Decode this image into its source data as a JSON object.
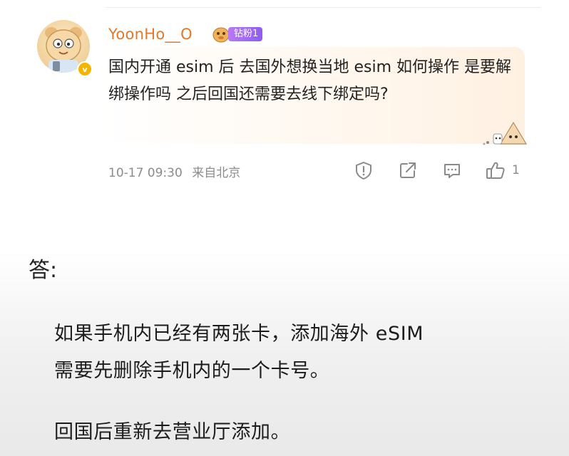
{
  "comment": {
    "username": "YoonHo__O",
    "fan_badge": "钻粉1",
    "text": "国内开通 esim 后 去国外想换当地 esim 如何操作 是要解绑操作吗 之后回国还需要去线下绑定吗?",
    "timestamp": "10-17 09:30",
    "location": "来自北京",
    "like_count": "1",
    "icons": [
      "report-icon",
      "share-icon",
      "reply-icon",
      "like-icon"
    ],
    "verified_color": "#f5b400",
    "username_color": "#e0792b"
  },
  "answer": {
    "label": "答:",
    "paragraph_1_line_1": "如果手机内已经有两张卡，添加海外 eSIM",
    "paragraph_1_line_2": "需要先删除手机内的一个卡号。",
    "paragraph_2": "回国后重新去营业厅添加。"
  }
}
